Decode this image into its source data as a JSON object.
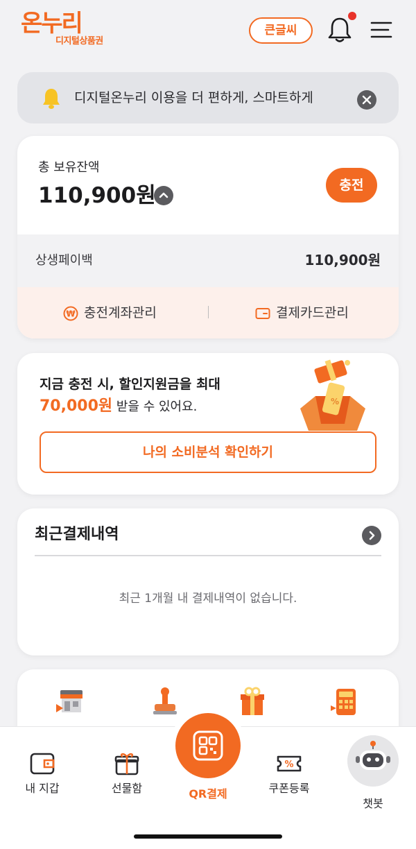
{
  "header": {
    "logo_main": "온누리",
    "logo_sub": "디지털상품권",
    "font_size_button": "큰글씨",
    "icons": [
      "bell-icon",
      "hamburger-menu-icon"
    ]
  },
  "notice": {
    "text": "디지털온누리 이용을 더 편하게, 스마트하게",
    "icons": [
      "bell-icon",
      "close-icon"
    ]
  },
  "balance": {
    "label": "총 보유잔액",
    "amount": "110,900원",
    "charge_button": "충전",
    "breakdown_label": "상생페이백",
    "breakdown_value": "110,900원",
    "actions": [
      "충전계좌관리",
      "결제카드관리"
    ]
  },
  "promo": {
    "line1": "지금 충전 시, 할인지원금을 최대",
    "amount": "70,000원",
    "suffix": " 받을 수 있어요.",
    "button": "나의 소비분석 확인하기"
  },
  "history": {
    "title": "최근결제내역",
    "empty_message": "최근 1개월 내 결제내역이 없습니다."
  },
  "shortcuts": {
    "icons": [
      "store-icon",
      "stamp-icon",
      "gift-box-icon",
      "calculator-icon"
    ]
  },
  "tabbar": {
    "tabs": [
      "내 지갑",
      "선물함",
      "QR결제",
      "쿠폰등록",
      "챗봇"
    ],
    "accent": "#f26a22"
  },
  "colors": {
    "brand": "#f26a22",
    "background": "#f2f2f4",
    "notice_bg": "#e3e4e8",
    "actions_bg": "#fdf0eb"
  }
}
